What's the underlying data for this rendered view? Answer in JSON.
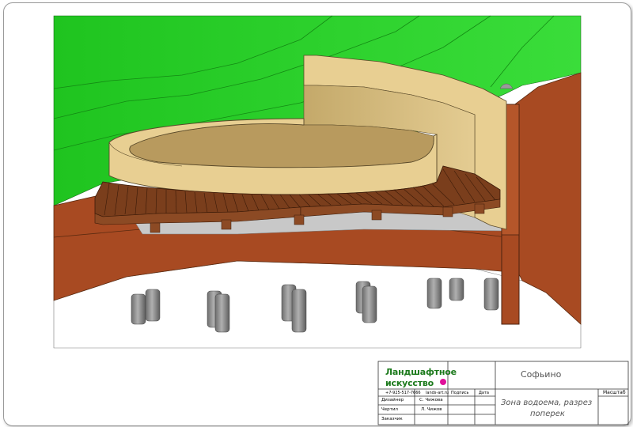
{
  "titleblock": {
    "company_line1": "Ландшафтное",
    "company_line2": "искусство",
    "company_phone": "+7-925-517-7666",
    "company_site": "lands-art.ru",
    "project_name": "Софьино",
    "sheet_title_line1": "Зона водоема, разрез",
    "sheet_title_line2": "поперек",
    "col_signature": "Подпись",
    "col_date": "Дата",
    "col_scale": "Масштаб",
    "roles": [
      {
        "role": "Дизайнер",
        "person": "С. Чижова"
      },
      {
        "role": "Чертил",
        "person": "Л. Чижов"
      },
      {
        "role": "Заказчик",
        "person": ""
      }
    ]
  },
  "colors": {
    "grass": "#22cc22",
    "soil": "#a84a22",
    "concrete": "#e8cf92",
    "deck": "#7a3e1c",
    "pile": "#8a8a8a",
    "sky": "#ffffff",
    "logo_green": "#1c7a1c",
    "logo_dot": "#e0109a"
  }
}
